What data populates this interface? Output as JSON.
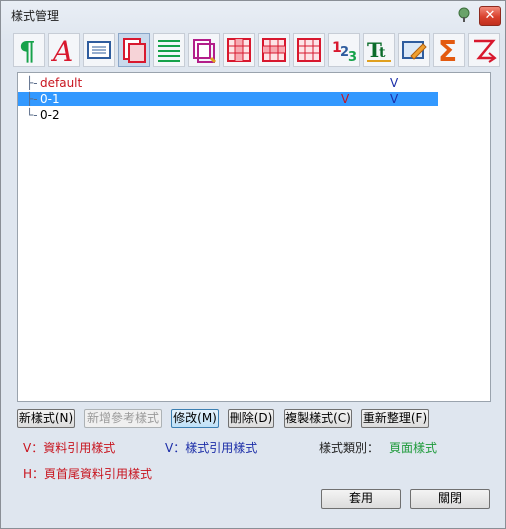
{
  "window": {
    "title": "樣式管理"
  },
  "toolbar": {
    "icons": [
      "paragraph-icon",
      "font-icon",
      "textbox-icon",
      "page-icon",
      "lines-icon",
      "frame-icon",
      "table-col-icon",
      "table-grid-icon",
      "table-row-icon",
      "numbering-icon",
      "text-case-icon",
      "edit-icon",
      "sum-icon",
      "merge-icon"
    ]
  },
  "tree": {
    "items": [
      {
        "label": "default",
        "conn": "├-",
        "v": "",
        "s": "V",
        "selected": false
      },
      {
        "label": "0-1",
        "conn": "├-",
        "v": "V",
        "s": "V",
        "selected": true
      },
      {
        "label": "0-2",
        "conn": "└-",
        "v": "",
        "s": "",
        "selected": false
      }
    ]
  },
  "buttons": {
    "new_style": "新樣式(N)",
    "new_ref_style": "新增參考樣式",
    "modify": "修改(M)",
    "delete": "刪除(D)",
    "copy_style": "複製樣式(C)",
    "reorganize": "重新整理(F)",
    "apply": "套用",
    "close": "關閉"
  },
  "legend": {
    "v_data": "V：資料引用樣式",
    "v_style": "V：樣式引用樣式",
    "category_label": "樣式類別：",
    "category_value": "頁面樣式",
    "h_header": "H：頁首尾資料引用樣式"
  },
  "colors": {
    "red": "#c8141e",
    "blue": "#1c2ea8",
    "green": "#1d9a3a",
    "selection": "#3399ff"
  }
}
